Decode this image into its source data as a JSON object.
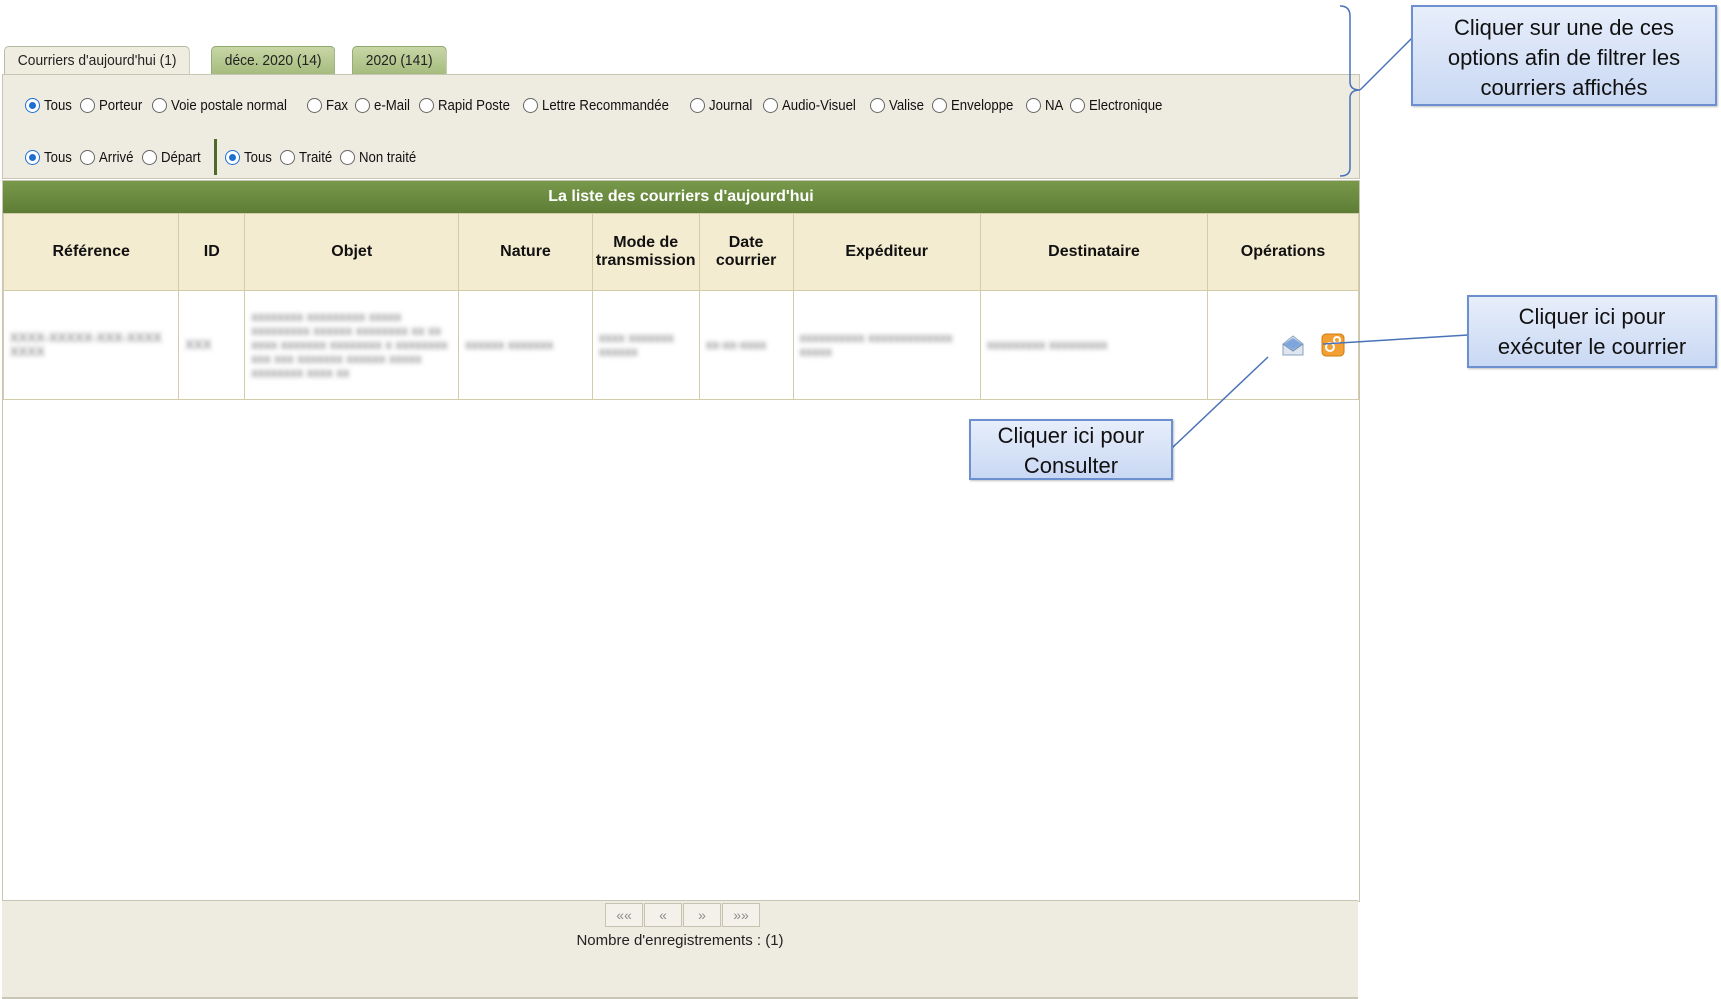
{
  "tabs": [
    {
      "label": "Courriers d'aujourd'hui (1)",
      "active": true
    },
    {
      "label": "déce. 2020 (14)",
      "active": false
    },
    {
      "label": "2020 (141)",
      "active": false
    }
  ],
  "filters": {
    "types": [
      "Tous",
      "Porteur",
      "Voie postale normal",
      "Fax",
      "e-Mail",
      "Rapid Poste",
      "Lettre Recommandée",
      "Journal",
      "Audio-Visuel",
      "Valise",
      "Enveloppe",
      "NA",
      "Electronique"
    ],
    "types_selected": "Tous",
    "direction": [
      "Tous",
      "Arrivé",
      "Départ"
    ],
    "direction_selected": "Tous",
    "status": [
      "Tous",
      "Traité",
      "Non traité"
    ],
    "status_selected": "Tous"
  },
  "grid": {
    "title": "La liste des courriers d'aujourd'hui",
    "headers": {
      "reference": "Référence",
      "id": "ID",
      "objet": "Objet",
      "nature": "Nature",
      "mode_a": "Mode de",
      "mode_b": "transmission",
      "date_a": "Date",
      "date_b": "courrier",
      "expediteur": "Expéditeur",
      "destinataire": "Destinataire",
      "operations": "Opérations"
    },
    "row": {
      "reference": "XXXX-XXXXX-XXX-XXXX XXXX",
      "id": "XXX",
      "objet": "xxxxxxxx xxxxxxxxx xxxxx xxxxxxxxx xxxxxx xxxxxxxx xx xx xxxx xxxxxxx xxxxxxxx x xxxxxxxx xxx xxx xxxxxxx xxxxxx xxxxx xxxxxxxx xxxx xx",
      "nature": "xxxxxx xxxxxxx",
      "mode": "xxxx xxxxxxx xxxxxx",
      "date": "xx-xx-xxxx",
      "expediteur": "xxxxxxxxxx xxxxxxxxxxxxx xxxxx",
      "destinataire": "xxxxxxxxx xxxxxxxxx"
    },
    "icons": {
      "view": "envelope-open-icon",
      "execute": "execute-gear-icon"
    }
  },
  "pager": {
    "first": "««",
    "prev": "«",
    "next": "»",
    "last": "»»"
  },
  "record_count": "Nombre d'enregistrements : (1)",
  "callouts": {
    "filters": "Cliquer sur une de ces options afin de filtrer les courriers affichés",
    "execute": "Cliquer ici pour exécuter le courrier",
    "consult": "Cliquer ici pour Consulter"
  },
  "colors": {
    "header_green": "#5d7d36",
    "header_cell": "#f4ecd1",
    "panel": "#eeebe0",
    "callout_border": "#6b8fcf"
  }
}
